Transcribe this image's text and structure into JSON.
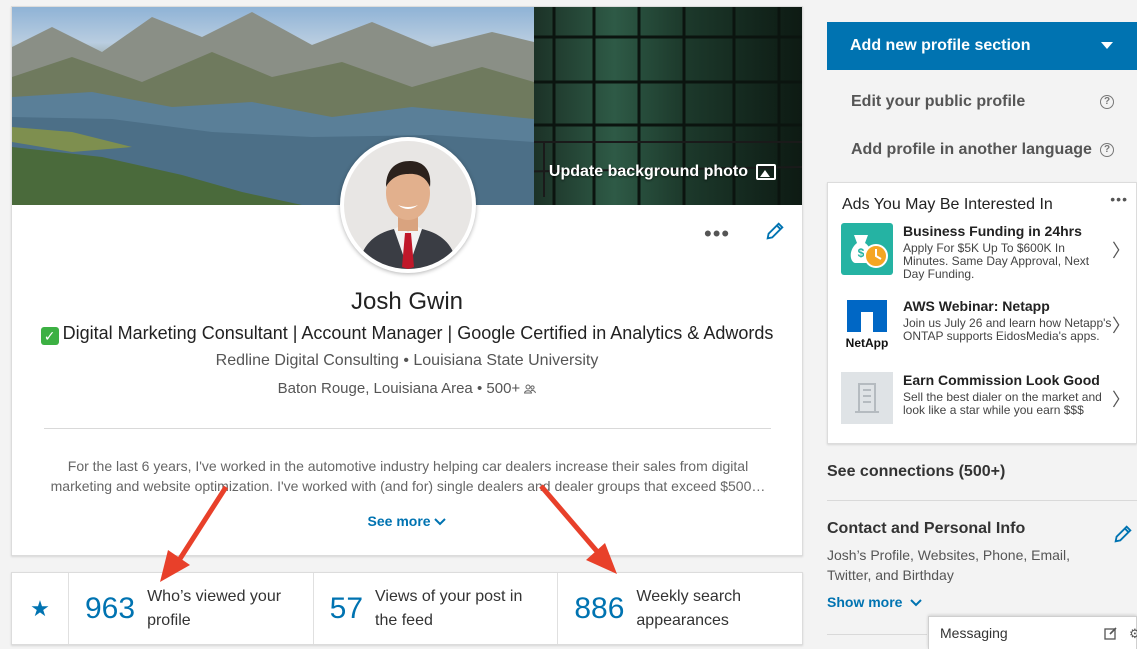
{
  "profile": {
    "update_background_label": "Update background photo",
    "name": "Josh Gwin",
    "headline": "Digital Marketing Consultant | Account Manager | Google Certified in Analytics & Adwords",
    "company": "Redline Digital Consulting",
    "school": "Louisiana State University",
    "location": "Baton Rouge, Louisiana Area",
    "connections": "500+",
    "separator": "•",
    "summary": "For the last 6 years, I've worked in the automotive industry helping car dealers increase their sales from digital marketing and website optimization. I've worked with (and for) single dealers and dealer groups that exceed $500…",
    "see_more_label": "See more"
  },
  "stats": [
    {
      "value": "963",
      "label": "Who’s viewed your profile"
    },
    {
      "value": "57",
      "label": "Views of your post in the feed"
    },
    {
      "value": "886",
      "label": "Weekly search appearances"
    }
  ],
  "rail": {
    "add_section_label": "Add new profile section",
    "edit_public_label": "Edit your public profile",
    "add_language_label": "Add profile in another language",
    "help_glyph": "?"
  },
  "ads": {
    "title": "Ads You May Be Interested In",
    "items": [
      {
        "title": "Business Funding in 24hrs",
        "desc": "Apply For $5K Up To $600K In Minutes. Same Day Approval, Next Day Funding.",
        "logo": "money-bag-clock-icon"
      },
      {
        "title": "AWS Webinar: Netapp",
        "desc": "Join us July 26 and learn how Netapp's ONTAP supports EidosMedia's apps.",
        "logo": "netapp-logo",
        "logo_text": "NetApp"
      },
      {
        "title": "Earn Commission Look Good",
        "desc": "Sell the best dialer on the market and look like a star while you earn $$$",
        "logo": "building-placeholder-icon"
      }
    ]
  },
  "connections": {
    "label": "See connections (500+)"
  },
  "contact": {
    "title": "Contact and Personal Info",
    "desc": "Josh’s Profile, Websites, Phone, Email, Twitter, and Birthday",
    "show_more_label": "Show more"
  },
  "messaging": {
    "label": "Messaging"
  },
  "colors": {
    "brand": "#0073b1",
    "check": "#3cb043",
    "arrow": "#e8402a"
  }
}
